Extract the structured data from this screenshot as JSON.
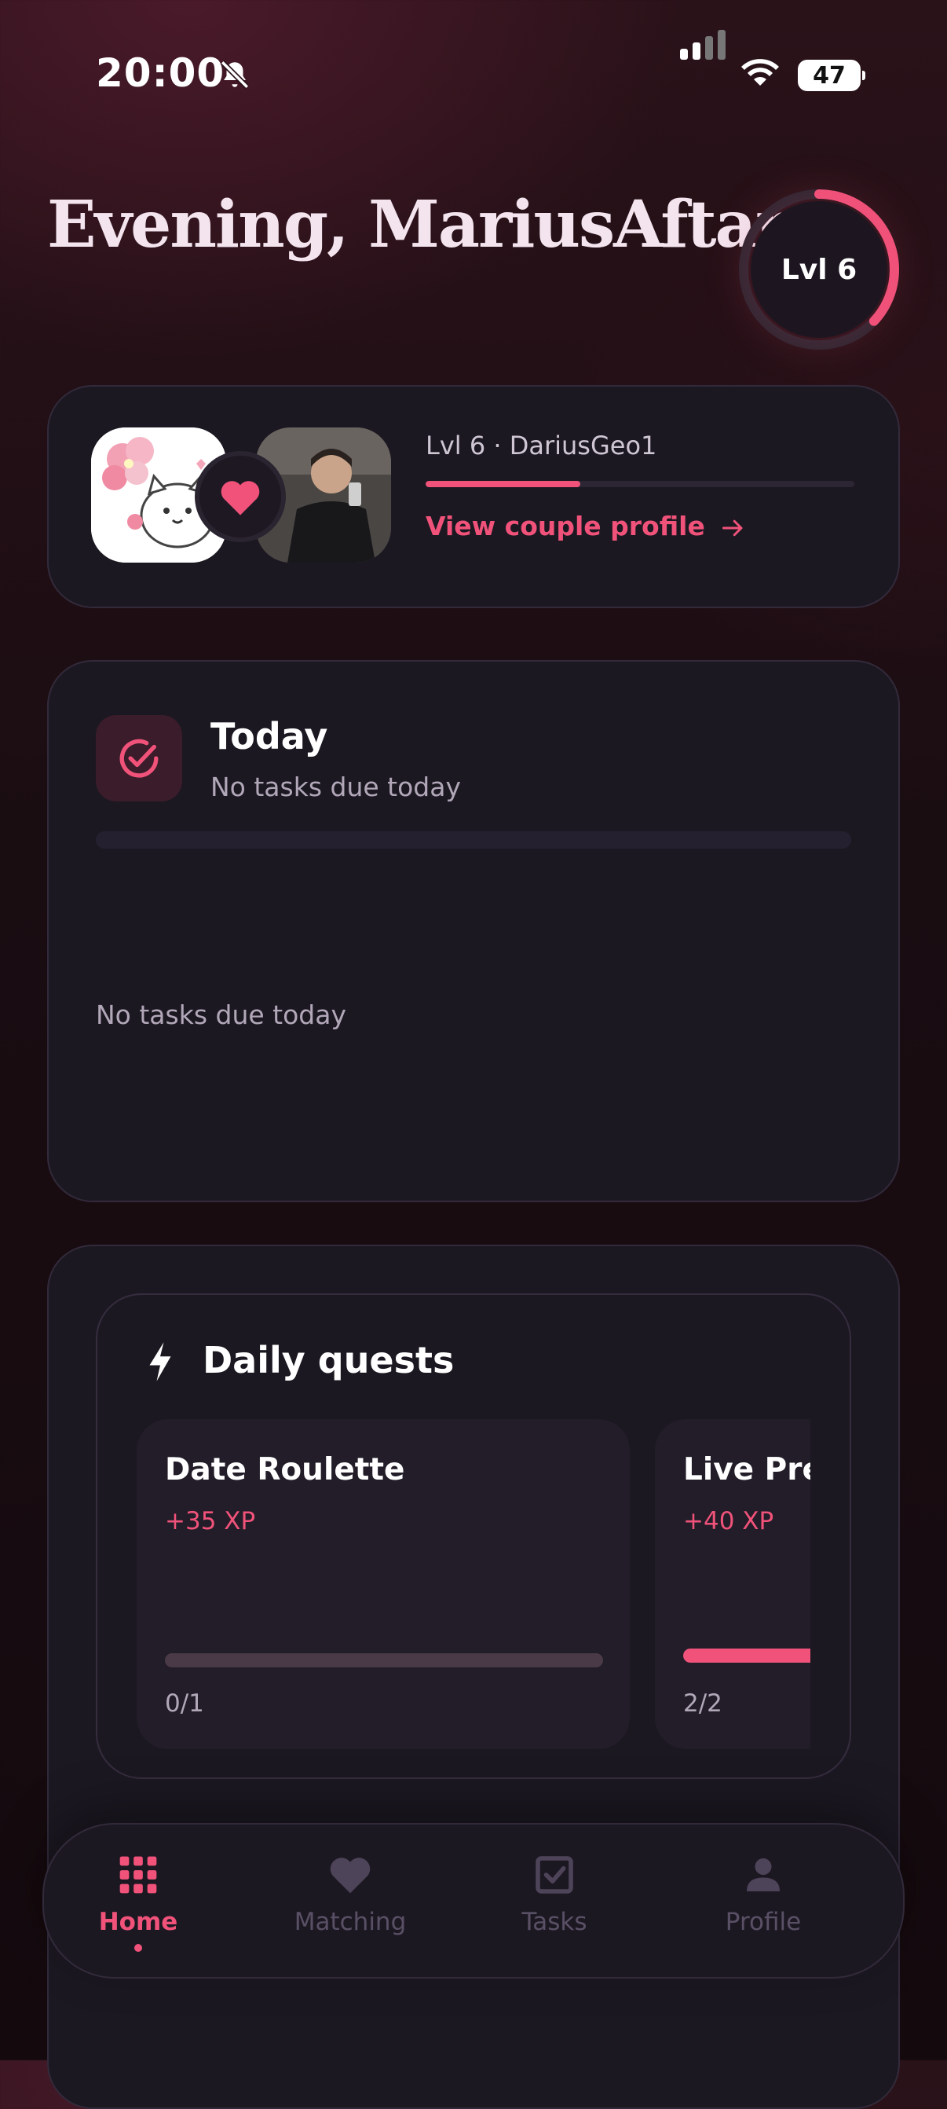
{
  "status_bar": {
    "time": "20:00",
    "battery": "47"
  },
  "header": {
    "greeting": "Evening, MariusAftan",
    "level_badge": "Lvl 6",
    "level_progress": 0.37
  },
  "couple": {
    "partner_line": "Lvl 6 · DariusGeo1",
    "xp_progress": 0.36,
    "link_label": "View couple profile"
  },
  "today": {
    "title": "Today",
    "subtitle": "No tasks due today",
    "empty_message": "No tasks due today"
  },
  "quests": {
    "title": "Daily quests",
    "items": [
      {
        "name": "Date Roulette",
        "xp": "+35 XP",
        "count": "0/1",
        "progress": 0
      },
      {
        "name": "Live Pre",
        "xp": "+40 XP",
        "count": "2/2",
        "progress": 1
      }
    ]
  },
  "nav": {
    "items": [
      {
        "label": "Home",
        "icon": "grid-icon",
        "active": true
      },
      {
        "label": "Matching",
        "icon": "heart-icon",
        "active": false
      },
      {
        "label": "Tasks",
        "icon": "checkbox-icon",
        "active": false
      },
      {
        "label": "Profile",
        "icon": "person-icon",
        "active": false
      }
    ]
  },
  "colors": {
    "accent": "#f0527a",
    "card": "#1c1822",
    "muted": "#b1a7b8"
  }
}
